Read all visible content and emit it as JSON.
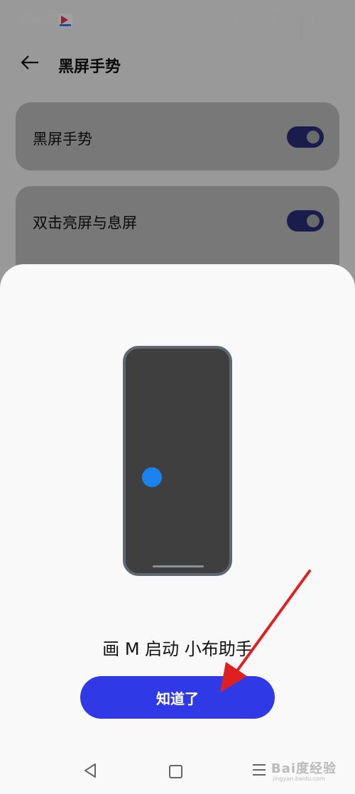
{
  "status_bar": {
    "time": "09:27",
    "hd": "HD",
    "network": "5G",
    "battery": "85"
  },
  "header": {
    "title": "黑屏手势"
  },
  "settings": [
    {
      "label": "黑屏手势",
      "enabled": true
    },
    {
      "label": "双击亮屏与息屏",
      "enabled": true
    }
  ],
  "sheet": {
    "caption": "画 M 启动 小布助手",
    "button_label": "知道了"
  },
  "colors": {
    "accent": "#2f3ae6",
    "dot": "#1a83f0",
    "toggle_on": "#2a2d78",
    "arrow": "#e02020"
  },
  "watermark": {
    "brand": "Bai度经验",
    "url": "jingyan.baidu.com"
  }
}
